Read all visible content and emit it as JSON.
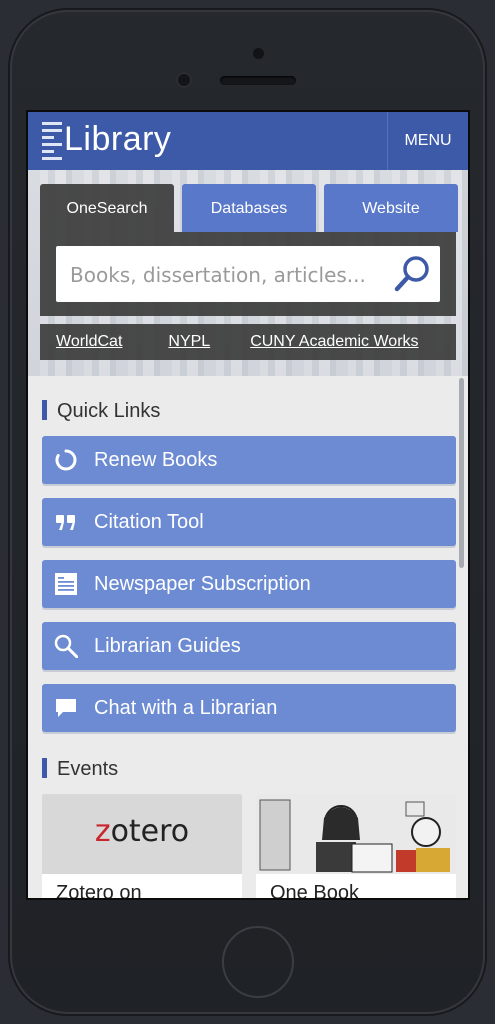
{
  "header": {
    "brand": "Library",
    "menu_label": "MENU"
  },
  "search": {
    "tabs": [
      {
        "label": "OneSearch",
        "active": true
      },
      {
        "label": "Databases",
        "active": false
      },
      {
        "label": "Website",
        "active": false
      }
    ],
    "placeholder": "Books, dissertation, articles...",
    "external_links": [
      "WorldCat",
      "NYPL",
      "CUNY Academic Works"
    ]
  },
  "quick_links": {
    "title": "Quick Links",
    "items": [
      {
        "label": "Renew Books",
        "icon": "renew-icon"
      },
      {
        "label": "Citation Tool",
        "icon": "quote-icon"
      },
      {
        "label": "Newspaper Subscription",
        "icon": "newspaper-icon"
      },
      {
        "label": "Librarian Guides",
        "icon": "search-icon"
      },
      {
        "label": "Chat with a Librarian",
        "icon": "chat-icon"
      }
    ]
  },
  "events": {
    "title": "Events",
    "cards": [
      {
        "title": "Zotero on",
        "image_text": "zotero"
      },
      {
        "title": "One Book"
      }
    ]
  },
  "colors": {
    "header_blue": "#3d5aa8",
    "quick_link_blue": "#6d8bd3",
    "panel_dark": "#3c3c3c"
  }
}
